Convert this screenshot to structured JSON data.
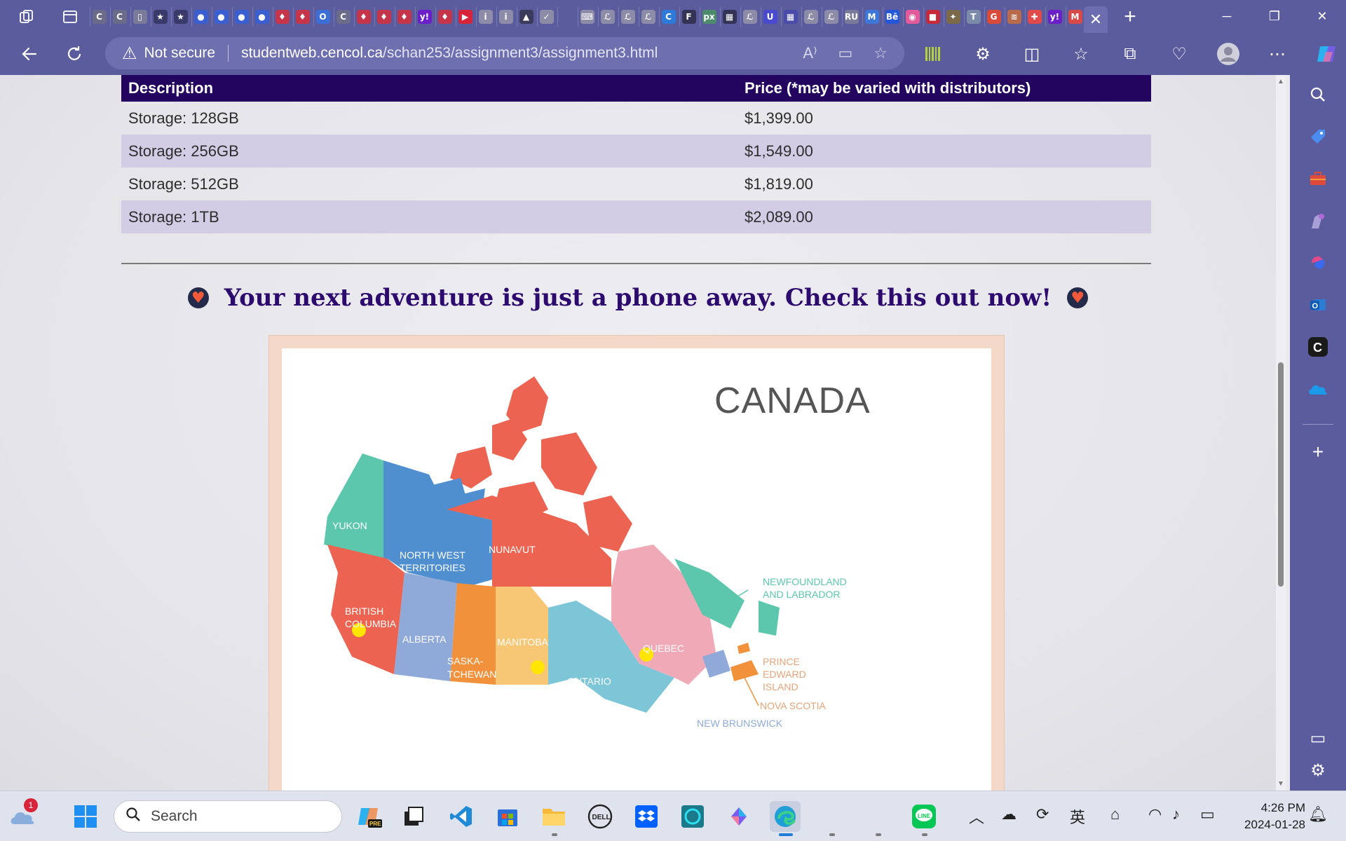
{
  "browser": {
    "tab_favicons": [
      {
        "icon": "c-icon",
        "color": "#6b6b8a",
        "glyph": "C"
      },
      {
        "icon": "c-icon",
        "color": "#6b6b8a",
        "glyph": "C"
      },
      {
        "icon": "doc-icon",
        "color": "#7a7a9a",
        "glyph": "▯"
      },
      {
        "icon": "star-icon",
        "color": "#3a3a6a",
        "glyph": "★"
      },
      {
        "icon": "star-icon",
        "color": "#3a3a6a",
        "glyph": "★"
      },
      {
        "icon": "blue-dot-icon",
        "color": "#3b5fd0",
        "glyph": "●"
      },
      {
        "icon": "blue-dot-icon",
        "color": "#3b5fd0",
        "glyph": "●"
      },
      {
        "icon": "blue-dot-icon",
        "color": "#3b5fd0",
        "glyph": "●"
      },
      {
        "icon": "blue-dot-icon",
        "color": "#3b5fd0",
        "glyph": "●"
      },
      {
        "icon": "maple-leaf-icon",
        "color": "#c4354a",
        "glyph": "♦"
      },
      {
        "icon": "maple-leaf-icon",
        "color": "#c4354a",
        "glyph": "♦"
      },
      {
        "icon": "o-icon",
        "color": "#3b6fd6",
        "glyph": "O"
      },
      {
        "icon": "c-icon",
        "color": "#6b6b8a",
        "glyph": "C"
      },
      {
        "icon": "maple-leaf-icon",
        "color": "#c4354a",
        "glyph": "♦"
      },
      {
        "icon": "maple-leaf-icon",
        "color": "#c4354a",
        "glyph": "♦"
      },
      {
        "icon": "maple-leaf-icon",
        "color": "#c4354a",
        "glyph": "♦"
      },
      {
        "icon": "yahoo-icon",
        "color": "#6a1fc9",
        "glyph": "y!"
      },
      {
        "icon": "maple-leaf-icon",
        "color": "#c4354a",
        "glyph": "♦"
      },
      {
        "icon": "youtube-icon",
        "color": "#d8243a",
        "glyph": "▶"
      },
      {
        "icon": "info-icon",
        "color": "#8c8ca8",
        "glyph": "i"
      },
      {
        "icon": "info-icon",
        "color": "#8c8ca8",
        "glyph": "i"
      },
      {
        "icon": "mountain-icon",
        "color": "#3a3a5a",
        "glyph": "▲"
      },
      {
        "icon": "swoosh-icon",
        "color": "#8c8ca8",
        "glyph": "✓"
      },
      {
        "icon": "blank-icon",
        "color": "#5b5c9e",
        "glyph": ""
      },
      {
        "icon": "keyboard-icon",
        "color": "#8c8ca8",
        "glyph": "⌨"
      },
      {
        "icon": "script-icon",
        "color": "#8c8ca8",
        "glyph": "ℒ"
      },
      {
        "icon": "script-icon",
        "color": "#8c8ca8",
        "glyph": "ℒ"
      },
      {
        "icon": "script-icon",
        "color": "#8c8ca8",
        "glyph": "ℒ"
      },
      {
        "icon": "c-blue-icon",
        "color": "#2e7ad8",
        "glyph": "C"
      },
      {
        "icon": "f-icon",
        "color": "#333355",
        "glyph": "F"
      },
      {
        "icon": "px-icon",
        "color": "#4c8c6c",
        "glyph": "px"
      },
      {
        "icon": "grid-icon",
        "color": "#333355",
        "glyph": "▦"
      },
      {
        "icon": "script-icon",
        "color": "#8c8ca8",
        "glyph": "ℒ"
      },
      {
        "icon": "u-icon",
        "color": "#4a4ad0",
        "glyph": "U"
      },
      {
        "icon": "grid-icon",
        "color": "#4a4aa8",
        "glyph": "▦"
      },
      {
        "icon": "script-icon",
        "color": "#8c8ca8",
        "glyph": "ℒ"
      },
      {
        "icon": "script-icon",
        "color": "#8c8ca8",
        "glyph": "ℒ"
      },
      {
        "icon": "ru-icon",
        "color": "#7a7a9a",
        "glyph": "RU"
      },
      {
        "icon": "m-icon",
        "color": "#3d77d8",
        "glyph": "M"
      },
      {
        "icon": "behance-icon",
        "color": "#2457d8",
        "glyph": "Bē"
      },
      {
        "icon": "dribbble-icon",
        "color": "#e35a9a",
        "glyph": "◉"
      },
      {
        "icon": "red-square-icon",
        "color": "#c42a3a",
        "glyph": "■"
      },
      {
        "icon": "bird-icon",
        "color": "#7a6a4a",
        "glyph": "✦"
      },
      {
        "icon": "t-icon",
        "color": "#7a8aa8",
        "glyph": "T"
      },
      {
        "icon": "g-icon",
        "color": "#d84a3a",
        "glyph": "G"
      },
      {
        "icon": "stripes-icon",
        "color": "#b86a4a",
        "glyph": "≋"
      },
      {
        "icon": "figma-icon",
        "color": "#e04a4a",
        "glyph": "✚"
      },
      {
        "icon": "yahoo-icon",
        "color": "#6a1fc9",
        "glyph": "y!"
      },
      {
        "icon": "gmail-icon",
        "color": "#d84a4a",
        "glyph": "M"
      }
    ],
    "address": {
      "security_label": "Not secure",
      "url_host": "studentweb.cencol.ca",
      "url_path": "/schan253/assignment3/assignment3.html"
    }
  },
  "page": {
    "table": {
      "headers": [
        "Description",
        "Price (*may be varied with distributors)"
      ],
      "rows": [
        [
          "Storage: 128GB",
          "$1,399.00"
        ],
        [
          "Storage: 256GB",
          "$1,549.00"
        ],
        [
          "Storage: 512GB",
          "$1,819.00"
        ],
        [
          "Storage: 1TB",
          "$2,089.00"
        ]
      ]
    },
    "tagline": "Your next adventure is just a phone away. Check this out now!",
    "map": {
      "title": "CANADA",
      "labels": {
        "yukon": "YUKON",
        "nwt_1": "NORTH WEST",
        "nwt_2": "TERRITORIES",
        "nunavut": "NUNAVUT",
        "bc_1": "BRITISH",
        "bc_2": "COLUMBIA",
        "alberta": "ALBERTA",
        "sask_1": "SASKA-",
        "sask_2": "TCHEWAN",
        "manitoba": "MANITOBA",
        "ontario": "ONTARIO",
        "quebec": "QUEBEC",
        "nl_1": "NEWFOUNDLAND",
        "nl_2": "AND LABRADOR",
        "pei_1": "PRINCE",
        "pei_2": "EDWARD",
        "pei_3": "ISLAND",
        "ns": "NOVA SCOTIA",
        "nb": "NEW BRUNSWICK"
      }
    }
  },
  "taskbar": {
    "weather_badge": "1",
    "search_placeholder": "Search",
    "time": "4:26 PM",
    "date": "2024-01-28",
    "ime_label": "英"
  }
}
